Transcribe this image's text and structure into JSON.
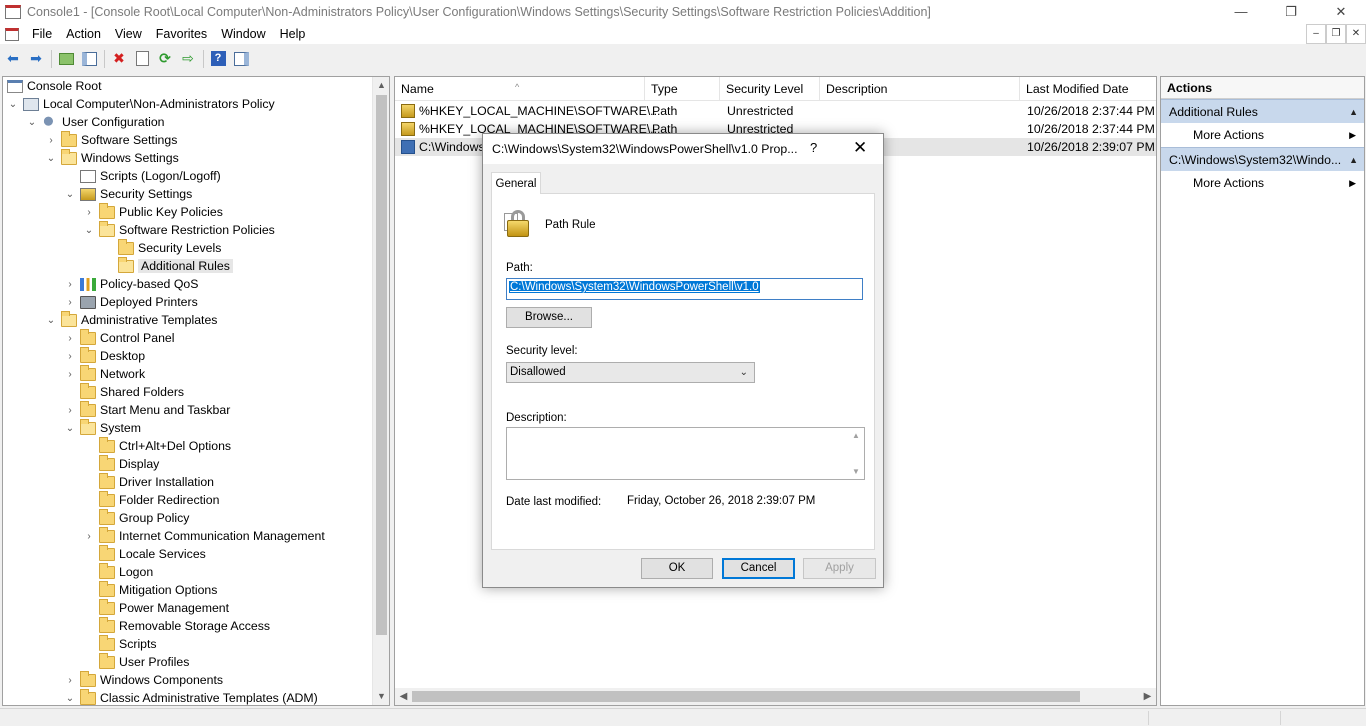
{
  "window": {
    "title": "Console1 - [Console Root\\Local Computer\\Non-Administrators Policy\\User Configuration\\Windows Settings\\Security Settings\\Software Restriction Policies\\Addition]",
    "minimize_glyph": "—",
    "maximize_glyph": "❐",
    "close_glyph": "✕"
  },
  "menu": {
    "items": [
      "File",
      "Action",
      "View",
      "Favorites",
      "Window",
      "Help"
    ],
    "mdi_min": "–",
    "mdi_restore": "❐",
    "mdi_close": "✕"
  },
  "toolbar": {
    "icons": [
      "back-arrow-icon",
      "forward-arrow-icon",
      "up-folder-icon",
      "show-hide-tree-icon",
      "delete-icon",
      "properties-icon",
      "refresh-icon",
      "export-list-icon",
      "help-icon",
      "show-hide-action-pane-icon"
    ],
    "back_glyph": "⬅",
    "forward_glyph": "➡",
    "delete_glyph": "✖",
    "refresh_glyph": "⟳",
    "export_glyph": "⇨",
    "help_glyph": "?"
  },
  "tree": {
    "items": [
      {
        "label": "Console Root"
      },
      {
        "label": "Local Computer\\Non-Administrators Policy"
      },
      {
        "label": "User Configuration"
      },
      {
        "label": "Software Settings"
      },
      {
        "label": "Windows Settings"
      },
      {
        "label": "Scripts (Logon/Logoff)"
      },
      {
        "label": "Security Settings"
      },
      {
        "label": "Public Key Policies"
      },
      {
        "label": "Software Restriction Policies"
      },
      {
        "label": "Security Levels"
      },
      {
        "label": "Additional Rules"
      },
      {
        "label": "Policy-based QoS"
      },
      {
        "label": "Deployed Printers"
      },
      {
        "label": "Administrative Templates"
      },
      {
        "label": "Control Panel"
      },
      {
        "label": "Desktop"
      },
      {
        "label": "Network"
      },
      {
        "label": "Shared Folders"
      },
      {
        "label": "Start Menu and Taskbar"
      },
      {
        "label": "System"
      },
      {
        "label": "Ctrl+Alt+Del Options"
      },
      {
        "label": "Display"
      },
      {
        "label": "Driver Installation"
      },
      {
        "label": "Folder Redirection"
      },
      {
        "label": "Group Policy"
      },
      {
        "label": "Internet Communication Management"
      },
      {
        "label": "Locale Services"
      },
      {
        "label": "Logon"
      },
      {
        "label": "Mitigation Options"
      },
      {
        "label": "Power Management"
      },
      {
        "label": "Removable Storage Access"
      },
      {
        "label": "Scripts"
      },
      {
        "label": "User Profiles"
      },
      {
        "label": "Windows Components"
      },
      {
        "label": "Classic Administrative Templates (ADM)"
      }
    ],
    "expanded_glyph": "⌄",
    "collapsed_glyph": "›",
    "scroll_up": "▲",
    "scroll_down": "▼"
  },
  "list": {
    "columns": [
      "Name",
      "Type",
      "Security Level",
      "Description",
      "Last Modified Date"
    ],
    "sort_glyph": "^",
    "rows": [
      {
        "name": "%HKEY_LOCAL_MACHINE\\SOFTWARE\\...",
        "type": "Path",
        "level": "Unrestricted",
        "description": "",
        "modified": "10/26/2018 2:37:44 PM"
      },
      {
        "name": "%HKEY_LOCAL_MACHINE\\SOFTWARE\\...",
        "type": "Path",
        "level": "Unrestricted",
        "description": "",
        "modified": "10/26/2018 2:37:44 PM"
      },
      {
        "name": "C:\\Windows",
        "type": "",
        "level": "",
        "description": "",
        "modified": "10/26/2018 2:39:07 PM"
      }
    ],
    "scroll_left": "◀",
    "scroll_right": "▶"
  },
  "actions": {
    "title": "Actions",
    "sections": [
      {
        "label": "Additional Rules",
        "item": "More Actions"
      },
      {
        "label": "C:\\Windows\\System32\\Windo...",
        "item": "More Actions"
      }
    ],
    "collapse_glyph": "▲",
    "submenu_glyph": "▶"
  },
  "dialog": {
    "title": "C:\\Windows\\System32\\WindowsPowerShell\\v1.0 Prop...",
    "help_glyph": "?",
    "close_glyph": "✕",
    "tab": "General",
    "rule_type": "Path Rule",
    "path_label": "Path:",
    "path_value": "C:\\Windows\\System32\\WindowsPowerShell\\v1.0",
    "browse_label": "Browse...",
    "security_level_label": "Security level:",
    "security_level_value": "Disallowed",
    "dropdown_glyph": "⌄",
    "description_label": "Description:",
    "description_value": "",
    "date_label": "Date last modified:",
    "date_value": "Friday, October 26, 2018  2:39:07 PM",
    "ok_label": "OK",
    "cancel_label": "Cancel",
    "apply_label": "Apply",
    "scroll_up": "▲",
    "scroll_down": "▼"
  }
}
